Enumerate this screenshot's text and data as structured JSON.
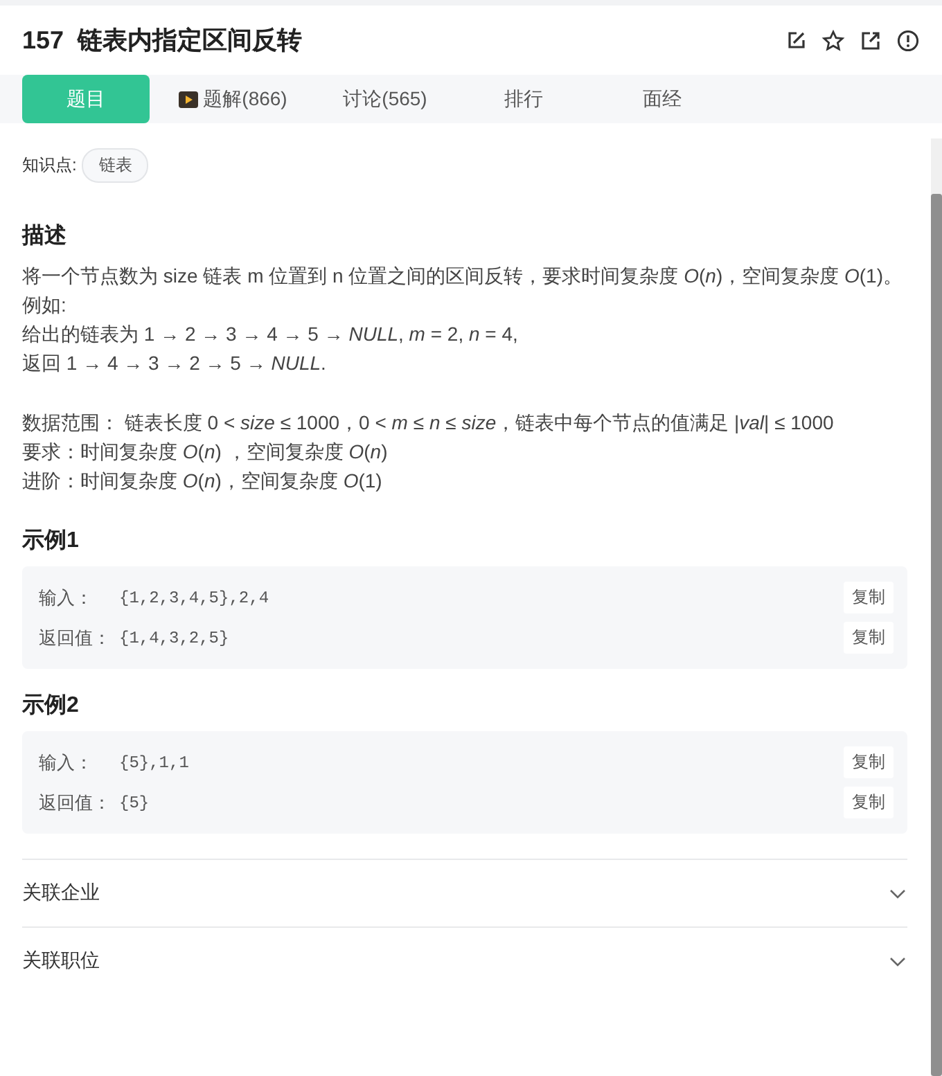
{
  "problem": {
    "number": "157",
    "title": "链表内指定区间反转"
  },
  "tabs": [
    {
      "label": "题目",
      "selected": true,
      "kind": "plain"
    },
    {
      "label": "题解(866)",
      "selected": false,
      "kind": "video"
    },
    {
      "label": "讨论(565)",
      "selected": false,
      "kind": "plain"
    },
    {
      "label": "排行",
      "selected": false,
      "kind": "plain"
    },
    {
      "label": "面经",
      "selected": false,
      "kind": "plain"
    }
  ],
  "knowledge": {
    "label": "知识点:",
    "tags": [
      "链表"
    ]
  },
  "description": {
    "heading": "描述",
    "blocks": [
      [
        "将一个节点数为 size 链表 m 位置到 n 位置之间的区间反转，要求时间复杂度 *O*(*n*)，空间复杂度 *O*(1)。",
        "例如:",
        "给出的链表为 1 → 2 → 3 → 4 → 5 → *NULL*, *m* = 2, *n* = 4,",
        "返回 1 → 4 → 3 → 2 → 5 → *NULL*."
      ],
      [
        "数据范围： 链表长度 0 < *size* ≤ 1000，0 < *m* ≤ *n* ≤ *size*，链表中每个节点的值满足 |*val*| ≤ 1000",
        "要求：时间复杂度 *O*(*n*) ，空间复杂度 *O*(*n*)",
        "进阶：时间复杂度 *O*(*n*)，空间复杂度 *O*(1)"
      ]
    ]
  },
  "examples": [
    {
      "heading": "示例1",
      "rows": [
        {
          "label": "输入：",
          "value": "{1,2,3,4,5},2,4",
          "button": "复制"
        },
        {
          "label": "返回值：",
          "value": "{1,4,3,2,5}",
          "button": "复制"
        }
      ]
    },
    {
      "heading": "示例2",
      "rows": [
        {
          "label": "输入：",
          "value": "{5},1,1",
          "button": "复制"
        },
        {
          "label": "返回值：",
          "value": "{5}",
          "button": "复制"
        }
      ]
    }
  ],
  "sections": [
    {
      "label": "关联企业",
      "expanded": false
    },
    {
      "label": "关联职位",
      "expanded": false
    }
  ]
}
